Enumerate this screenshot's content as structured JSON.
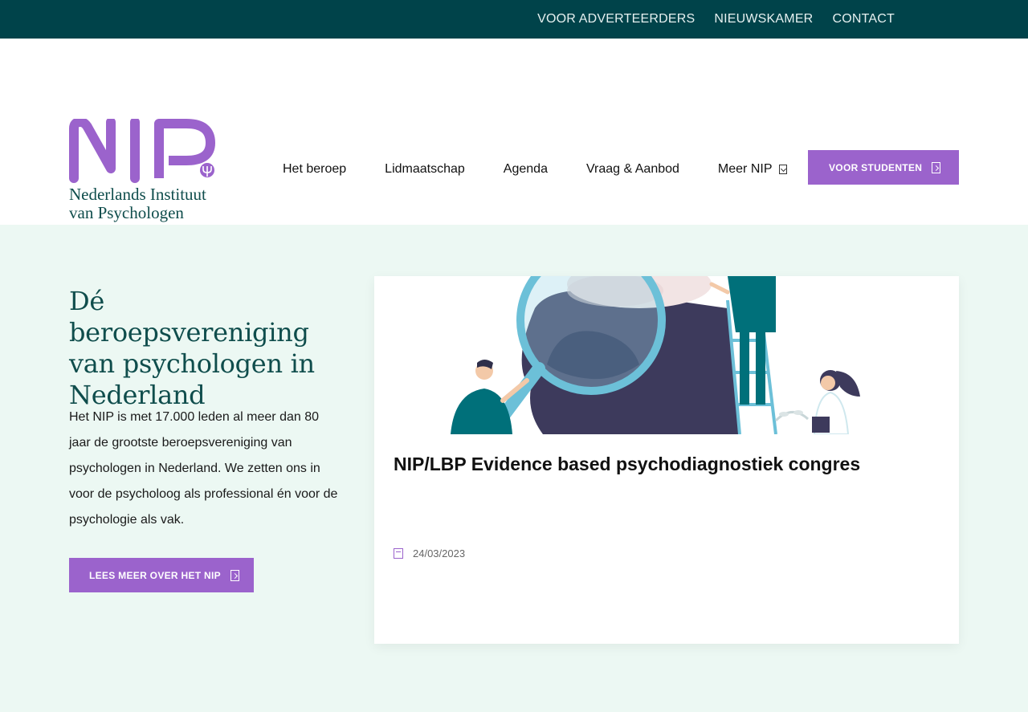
{
  "topbar": {
    "links": [
      "VOOR ADVERTEERDERS",
      "NIEUWSKAMER",
      "CONTACT"
    ]
  },
  "logo": {
    "mark": "NIP",
    "line1": "Nederlands Instituut",
    "line2": "van Psychologen"
  },
  "nav": {
    "items": [
      "Het beroep",
      "Lidmaatschap",
      "Agenda",
      "Vraag & Aanbod",
      "Meer NIP"
    ],
    "cta": "VOOR STUDENTEN"
  },
  "hero": {
    "title": "Dé beroepsvereniging van psychologen in Nederland",
    "text": "Het NIP is met 17.000 leden al meer dan 80 jaar de grootste beroepsvereniging van psychologen in Nederland. We zetten ons in voor de psycholoog als professional én voor de psychologie als vak.",
    "button": "LEES MEER OVER HET NIP"
  },
  "news_card": {
    "title": "NIP/LBP Evidence based psychodiagnostiek congres",
    "date": "24/03/2023"
  },
  "colors": {
    "topbar": "#00434a",
    "accent": "#9b63cc",
    "hero_bg": "#ecf8f3",
    "heading": "#0f4d4c"
  }
}
